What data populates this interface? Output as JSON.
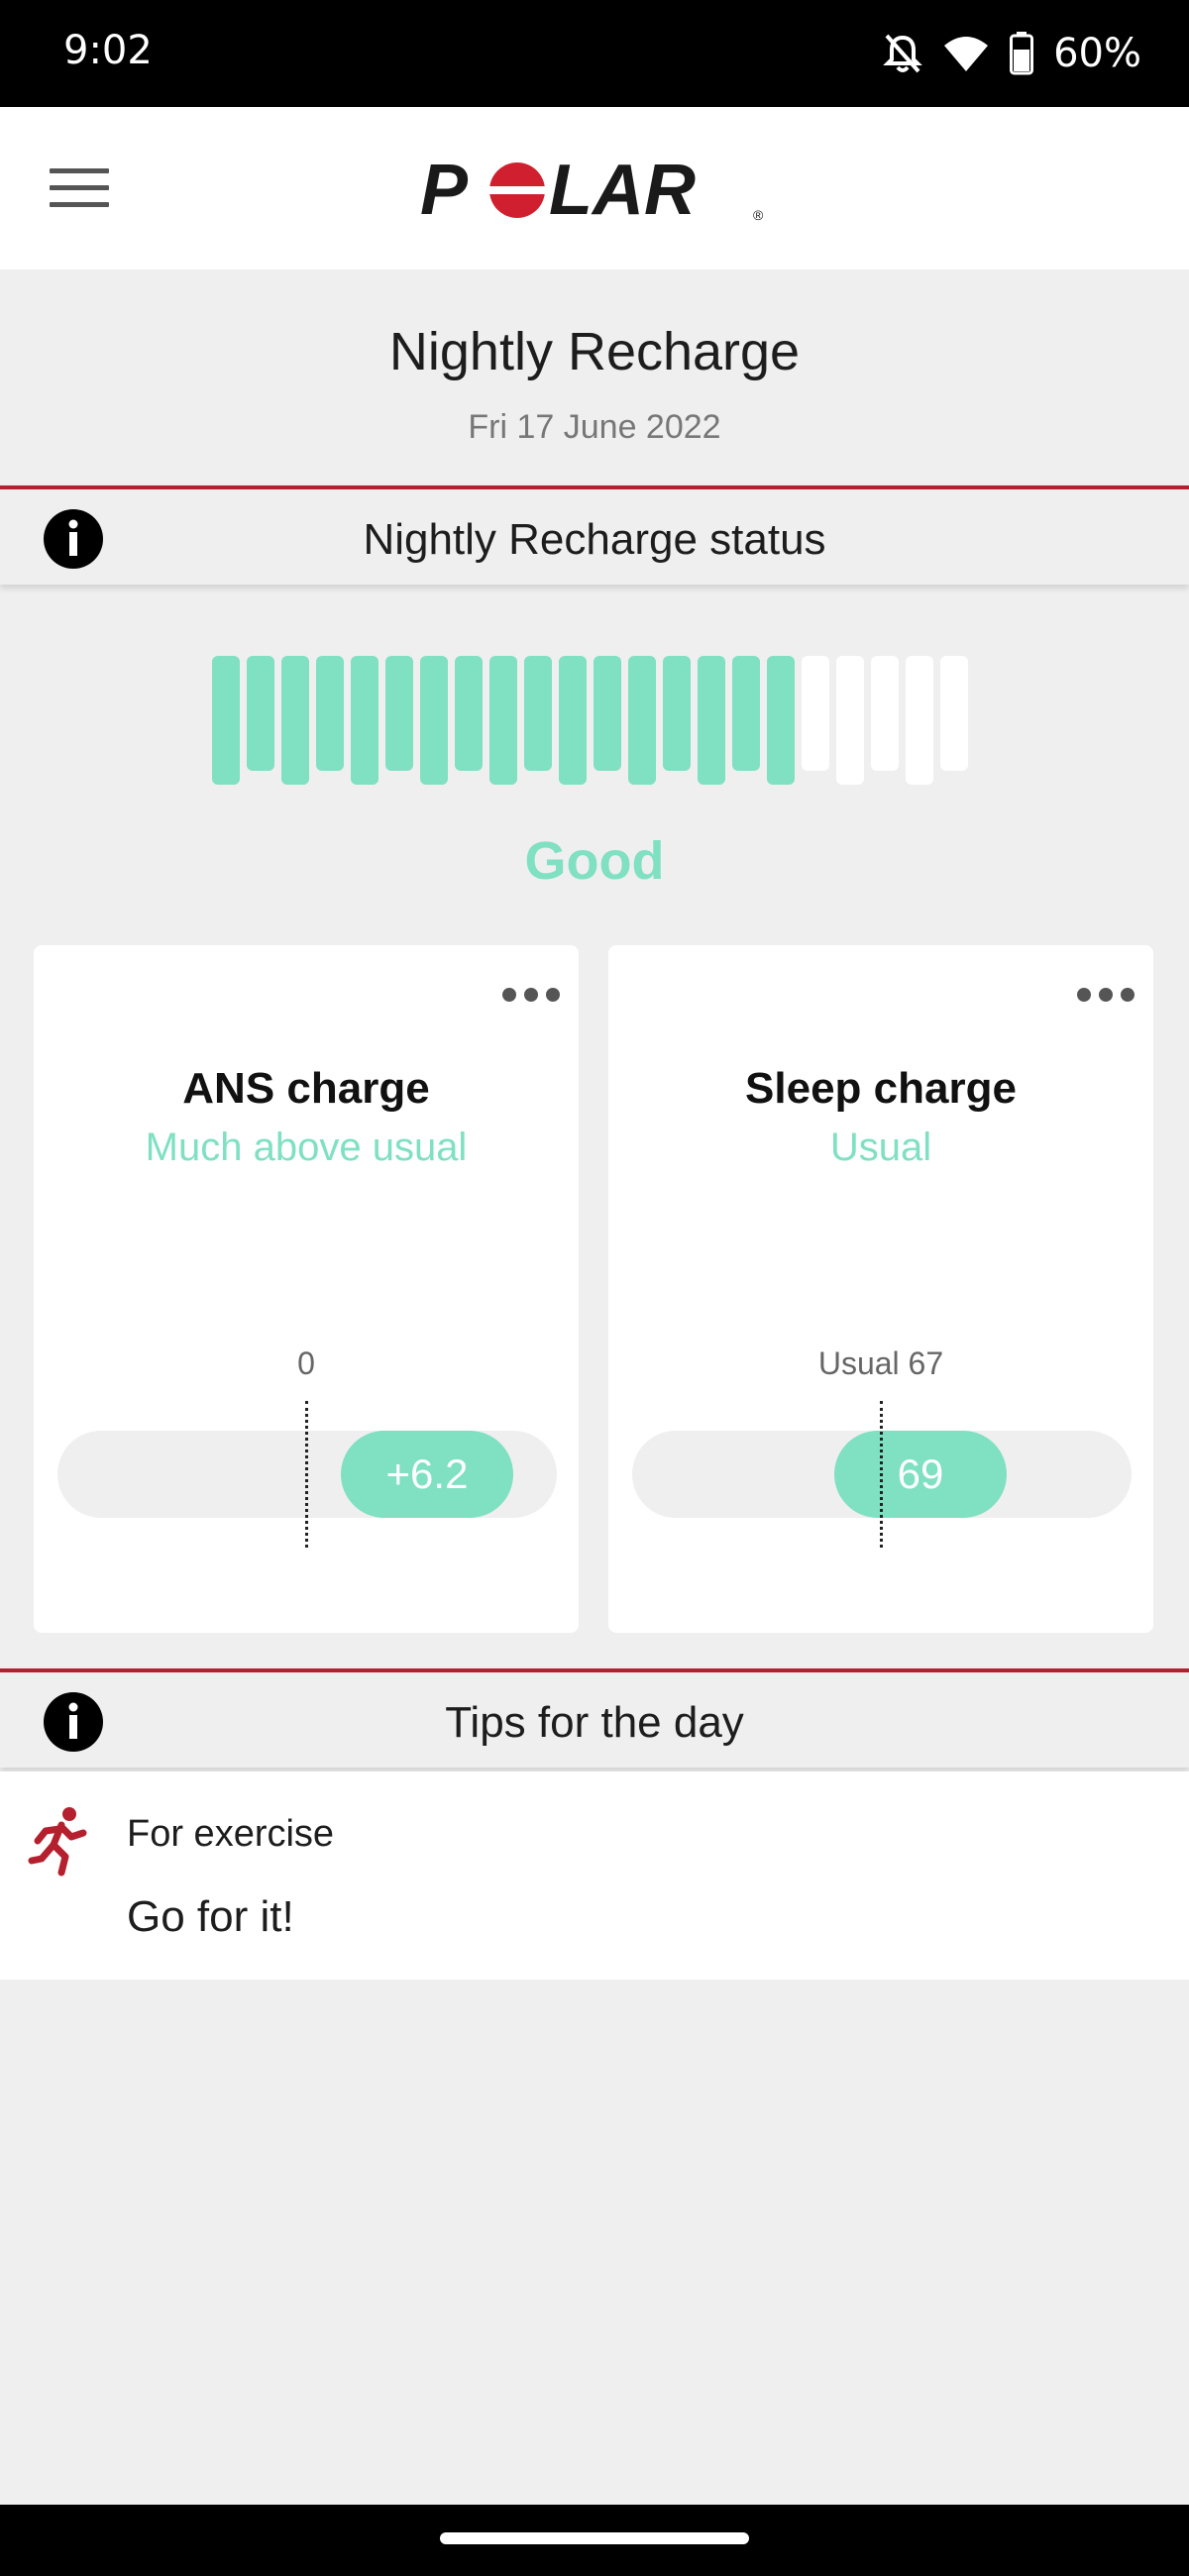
{
  "status_bar": {
    "time": "9:02",
    "battery_percent": "60%",
    "icons": [
      "notifications-off-icon",
      "wifi-icon",
      "battery-icon"
    ]
  },
  "app_bar": {
    "logo_text": "POLAR",
    "menu_icon": "menu-icon"
  },
  "header": {
    "title": "Nightly Recharge",
    "date": "Fri 17 June 2022"
  },
  "recharge_status": {
    "section_title": "Nightly Recharge status",
    "filled_bars": 17,
    "total_bars": 22,
    "status_text": "Good"
  },
  "cards": [
    {
      "title": "ANS charge",
      "subtitle": "Much above usual",
      "reference_label": "0",
      "value": "+6.2"
    },
    {
      "title": "Sleep charge",
      "subtitle": "Usual",
      "reference_label": "Usual 67",
      "value": "69"
    }
  ],
  "tips": {
    "section_title": "Tips for the day",
    "items": [
      {
        "category": "For exercise",
        "text": "Go for it!",
        "icon": "running-icon"
      }
    ]
  },
  "colors": {
    "accent_green": "#7fe0c2",
    "brand_red": "#b5202e",
    "logo_red": "#d0202f",
    "bar_empty": "#ffffff"
  }
}
